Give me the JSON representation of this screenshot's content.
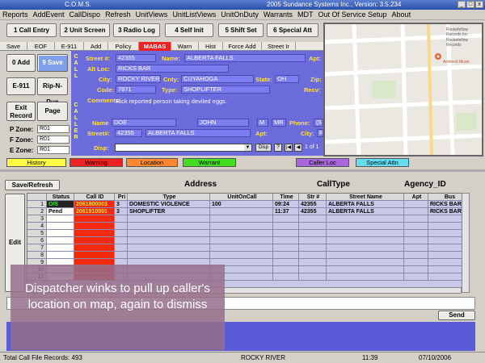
{
  "window": {
    "title_left": "C.O.M.S.",
    "title_right": "2005 Sundance Systems Inc., Version: 3.5.234"
  },
  "menu": [
    "Reports",
    "AddEvent",
    "CallDispo",
    "Refresh",
    "UnitViews",
    "UnitListViews",
    "UnitOnDuty",
    "Warrants",
    "MDT",
    "Out Of Service Setup",
    "About"
  ],
  "toolbar": [
    "1 Call Entry",
    "2 Unit Screen",
    "3 Radio Log",
    "4 Self Init",
    "5 Shift Set",
    "6 Special Att"
  ],
  "tabs": [
    "Save",
    "EOF",
    "E-911",
    "Add",
    "Policy",
    "MABAS",
    "Warn",
    "Hist",
    "Force Add",
    "Street Ir"
  ],
  "left_buttons": {
    "add": "0 Add",
    "save": "9 Save",
    "e911": "E-911",
    "rip": "Rip-N-Run",
    "exit": "Exit Record",
    "page": "Page"
  },
  "zones": [
    {
      "label": "P Zone:",
      "value": "R01"
    },
    {
      "label": "F Zone:",
      "value": "R01"
    },
    {
      "label": "E Zone:",
      "value": "R01"
    }
  ],
  "call_vertical": "CALL",
  "caller_vertical": "CALLER",
  "call": {
    "street_label": "Street #:",
    "street_no": "42355",
    "name_label": "Name:",
    "name": "ALBERTA FALLS",
    "apt_label": "Apt:",
    "alt_loc_label": "Alt Loc:",
    "alt_loc": "RICKS BAR",
    "city_label": "City:",
    "city": "ROCKY RIVER",
    "cnty_label": "Cnty:",
    "cnty": "CUYAHOGA",
    "state_label": "State:",
    "state": "OH",
    "zip_label": "Zip:",
    "code_label": "Code:",
    "code": "7871",
    "type_label": "Type:",
    "type": "SHOPLIFTER",
    "recv_label": "Recv:",
    "comments_label": "Comments:",
    "comments": "Rick reported person taking deviled eggs."
  },
  "caller": {
    "name_label": "Name",
    "last": "DOE",
    "first": "JOHN",
    "mi": "M",
    "title": "MR",
    "phone_label": "Phone:",
    "phone": "(5",
    "street_label": "Street#:",
    "street_no": "42355",
    "street": "ALBERTA FALLS",
    "apt_label": "Apt:",
    "city_label": "City:",
    "city": "R",
    "disp_label": "Disp:",
    "disp_btn": "Disp",
    "help_btn": "?",
    "page_info": "1 of 1"
  },
  "map": {
    "place": "Rockefellow Records Inc",
    "place_sub": "Rockefellow Records",
    "pin_label": "Amherst Music"
  },
  "chips": [
    {
      "label": "History",
      "color": "#ffff44"
    },
    {
      "label": "Warning",
      "color": "#ee2222"
    },
    {
      "label": "Location",
      "color": "#ff8833"
    },
    {
      "label": "Warrant",
      "color": "#44dd22"
    },
    {
      "label": "Caller Loc",
      "color": "#aa66dd"
    },
    {
      "label": "Special Attn",
      "color": "#66ddee"
    }
  ],
  "grid_header": {
    "save_refresh": "Save/Refresh",
    "address": "Address",
    "calltype": "CallType",
    "agency": "Agency_ID",
    "edit": "Edit"
  },
  "columns": [
    "Status",
    "Call ID",
    "Pri",
    "Type",
    "UnitOnCall",
    "Time",
    "Str #",
    "Street Name",
    "Apt",
    "Bus"
  ],
  "rows": [
    [
      "O/S",
      "2061800003",
      "3",
      "DOMESTIC VIOLENCE",
      "100",
      "09:24",
      "42355",
      "ALBERTA FALLS",
      "",
      "RICKS BAR"
    ],
    [
      "Pend",
      "2061910001",
      "3",
      "SHOPLIFTER",
      "",
      "11:37",
      "42355",
      "ALBERTA FALLS",
      "",
      "RICKS BAR"
    ]
  ],
  "row_numbers": [
    "1",
    "2",
    "3",
    "4",
    "5",
    "6",
    "7",
    "8",
    "9",
    "10",
    "11"
  ],
  "send_label": "Send",
  "overlay_text": "Dispatcher winks to pull up caller's location on map, again to dismiss",
  "status": {
    "records": "Total Call File Records: 493",
    "city": "ROCKY RIVER",
    "time": "11:39",
    "date": "07/10/2006"
  }
}
